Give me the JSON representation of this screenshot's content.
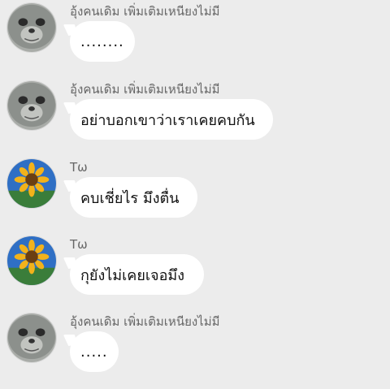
{
  "chat": {
    "messages": [
      {
        "sender": "อุ้งคนเดิม เพิ่มเติมเหนียงไม่มี",
        "avatar": "seal-avatar",
        "text": "........"
      },
      {
        "sender": "อุ้งคนเดิม เพิ่มเติมเหนียงไม่มี",
        "avatar": "seal-avatar",
        "text": "อย่าบอกเขาว่าเราเคยคบกัน"
      },
      {
        "sender": "Tω",
        "avatar": "sunflower-avatar",
        "text": "คบเชี่ยไร มึงตื่น"
      },
      {
        "sender": "Tω",
        "avatar": "sunflower-avatar",
        "text": "กุยังไม่เคยเจอมึง"
      },
      {
        "sender": "อุ้งคนเดิม เพิ่มเติมเหนียงไม่มี",
        "avatar": "seal-avatar",
        "text": "....."
      }
    ]
  },
  "colors": {
    "background": "#ececec",
    "bubble": "#ffffff",
    "sender_text": "#666666",
    "message_text": "#111111"
  }
}
